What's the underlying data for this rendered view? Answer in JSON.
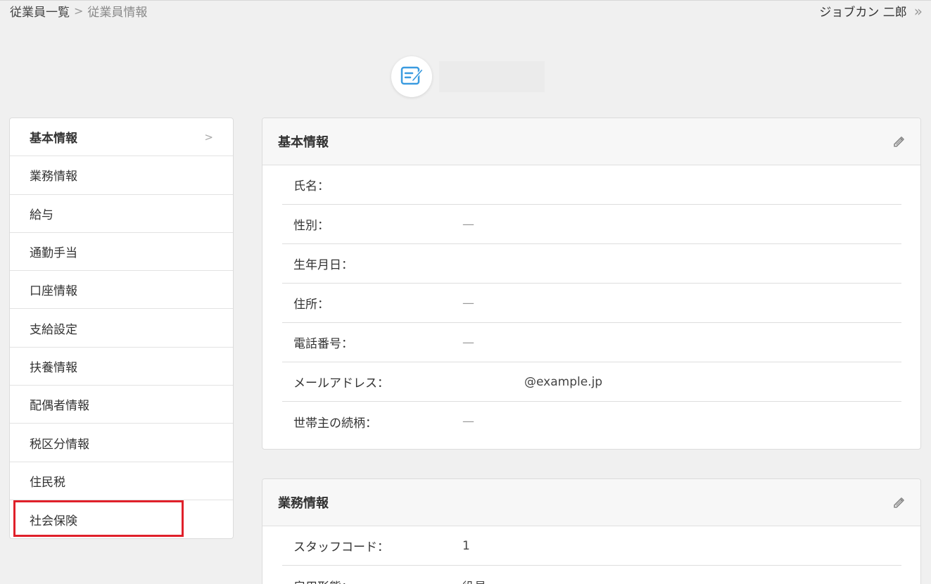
{
  "breadcrumb": {
    "items": [
      "従業員一覧",
      "従業員情報"
    ],
    "separator": ">"
  },
  "user": {
    "name": "ジョブカン 二郎",
    "next_icon": "»"
  },
  "sidebar": {
    "items": [
      {
        "label": "基本情報",
        "active": true
      },
      {
        "label": "業務情報"
      },
      {
        "label": "給与"
      },
      {
        "label": "通勤手当"
      },
      {
        "label": "口座情報"
      },
      {
        "label": "支給設定"
      },
      {
        "label": "扶養情報"
      },
      {
        "label": "配偶者情報"
      },
      {
        "label": "税区分情報"
      },
      {
        "label": "住民税"
      },
      {
        "label": "社会保険"
      }
    ],
    "active_chevron": ">"
  },
  "basic_info": {
    "title": "基本情報",
    "rows": [
      {
        "label": "氏名：",
        "value": ""
      },
      {
        "label": "性別：",
        "value": "—"
      },
      {
        "label": "生年月日：",
        "value": ""
      },
      {
        "label": "住所：",
        "value": "—"
      },
      {
        "label": "電話番号：",
        "value": "—"
      },
      {
        "label": "メールアドレス：",
        "value": "@example.jp"
      },
      {
        "label": "世帯主の続柄：",
        "value": "—"
      }
    ]
  },
  "work_info": {
    "title": "業務情報",
    "rows": [
      {
        "label": "スタッフコード：",
        "value": "1"
      },
      {
        "label": "雇用形態：",
        "value": "役員"
      }
    ]
  },
  "colors": {
    "highlight": "#e0202a",
    "icon_blue": "#3a9be0"
  }
}
